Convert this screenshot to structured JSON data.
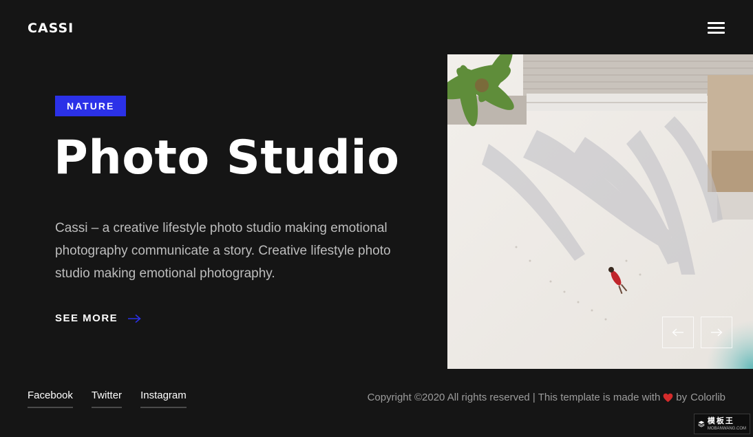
{
  "header": {
    "logo": "CASSI",
    "menu_icon": "hamburger-menu-icon"
  },
  "hero": {
    "tag": "NATURE",
    "title": "Photo Studio",
    "description": "Cassi – a creative lifestyle photo studio making emotional photography communicate a story. Creative lifestyle photo studio making emotional photography.",
    "cta_label": "SEE MORE",
    "cta_icon": "arrow-right-icon",
    "accent_color": "#2b31e8"
  },
  "slider": {
    "image_description_icon": "beach-aerial-photo",
    "prev_icon": "arrow-left-icon",
    "next_icon": "arrow-right-icon"
  },
  "footer": {
    "social": [
      "Facebook",
      "Twitter",
      "Instagram"
    ],
    "copyright_text": "Copyright ©2020 All rights reserved | This template is made with",
    "heart_icon": "heart-icon",
    "by_text": "by",
    "credit_link": "Colorlib"
  },
  "watermark": {
    "cn": "模板王",
    "en": "MOBANWANG.COM"
  }
}
